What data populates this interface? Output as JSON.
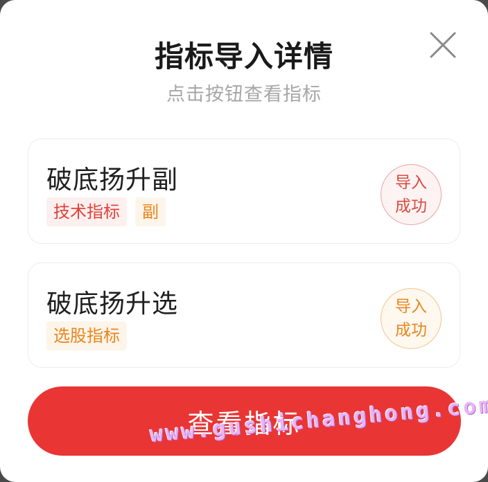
{
  "dialog": {
    "title": "指标导入详情",
    "subtitle": "点击按钮查看指标",
    "close_icon": "close-icon"
  },
  "items": [
    {
      "name": "破底扬升副",
      "tags": [
        "技术指标",
        "副"
      ],
      "status_line1": "导入",
      "status_line2": "成功",
      "status_color": "#d9493f"
    },
    {
      "name": "破底扬升选",
      "tags": [
        "选股指标"
      ],
      "status_line1": "导入",
      "status_line2": "成功",
      "status_color": "#e8861d"
    }
  ],
  "cta": {
    "label": "查看指标",
    "color": "#ea3535"
  },
  "watermark": {
    "text": "www.gushichanghong.com"
  }
}
